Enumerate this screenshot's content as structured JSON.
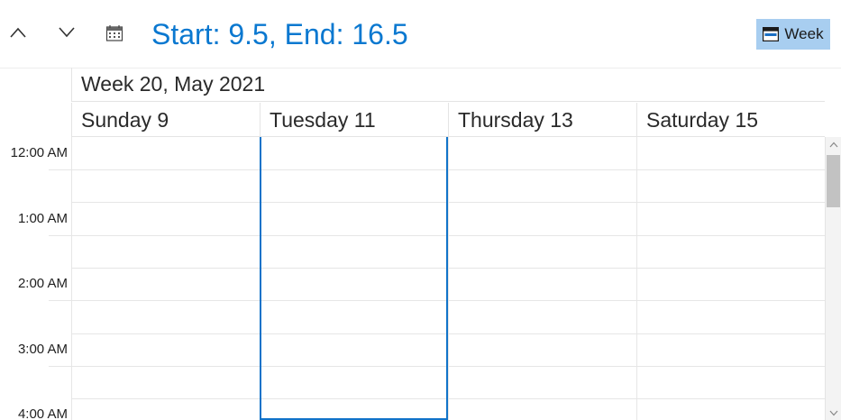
{
  "toolbar": {
    "title": "Start: 9.5, End: 16.5",
    "view_button_label": "Week",
    "prev_icon": "chevron-up-icon",
    "next_icon": "chevron-down-icon",
    "calendar_icon": "calendar-icon"
  },
  "calendar": {
    "week_label": "Week 20, May 2021",
    "days": [
      {
        "label": "Sunday 9"
      },
      {
        "label": "Tuesday 11"
      },
      {
        "label": "Thursday 13"
      },
      {
        "label": "Saturday 15"
      }
    ],
    "time_slots": [
      "12:00 AM",
      "1:00 AM",
      "2:00 AM",
      "3:00 AM",
      "4:00 AM"
    ],
    "selected_day": "Tuesday 11"
  },
  "colors": {
    "accent": "#0a78d0",
    "selection_border": "#1173c9",
    "view_button_bg": "#a8cef0"
  }
}
